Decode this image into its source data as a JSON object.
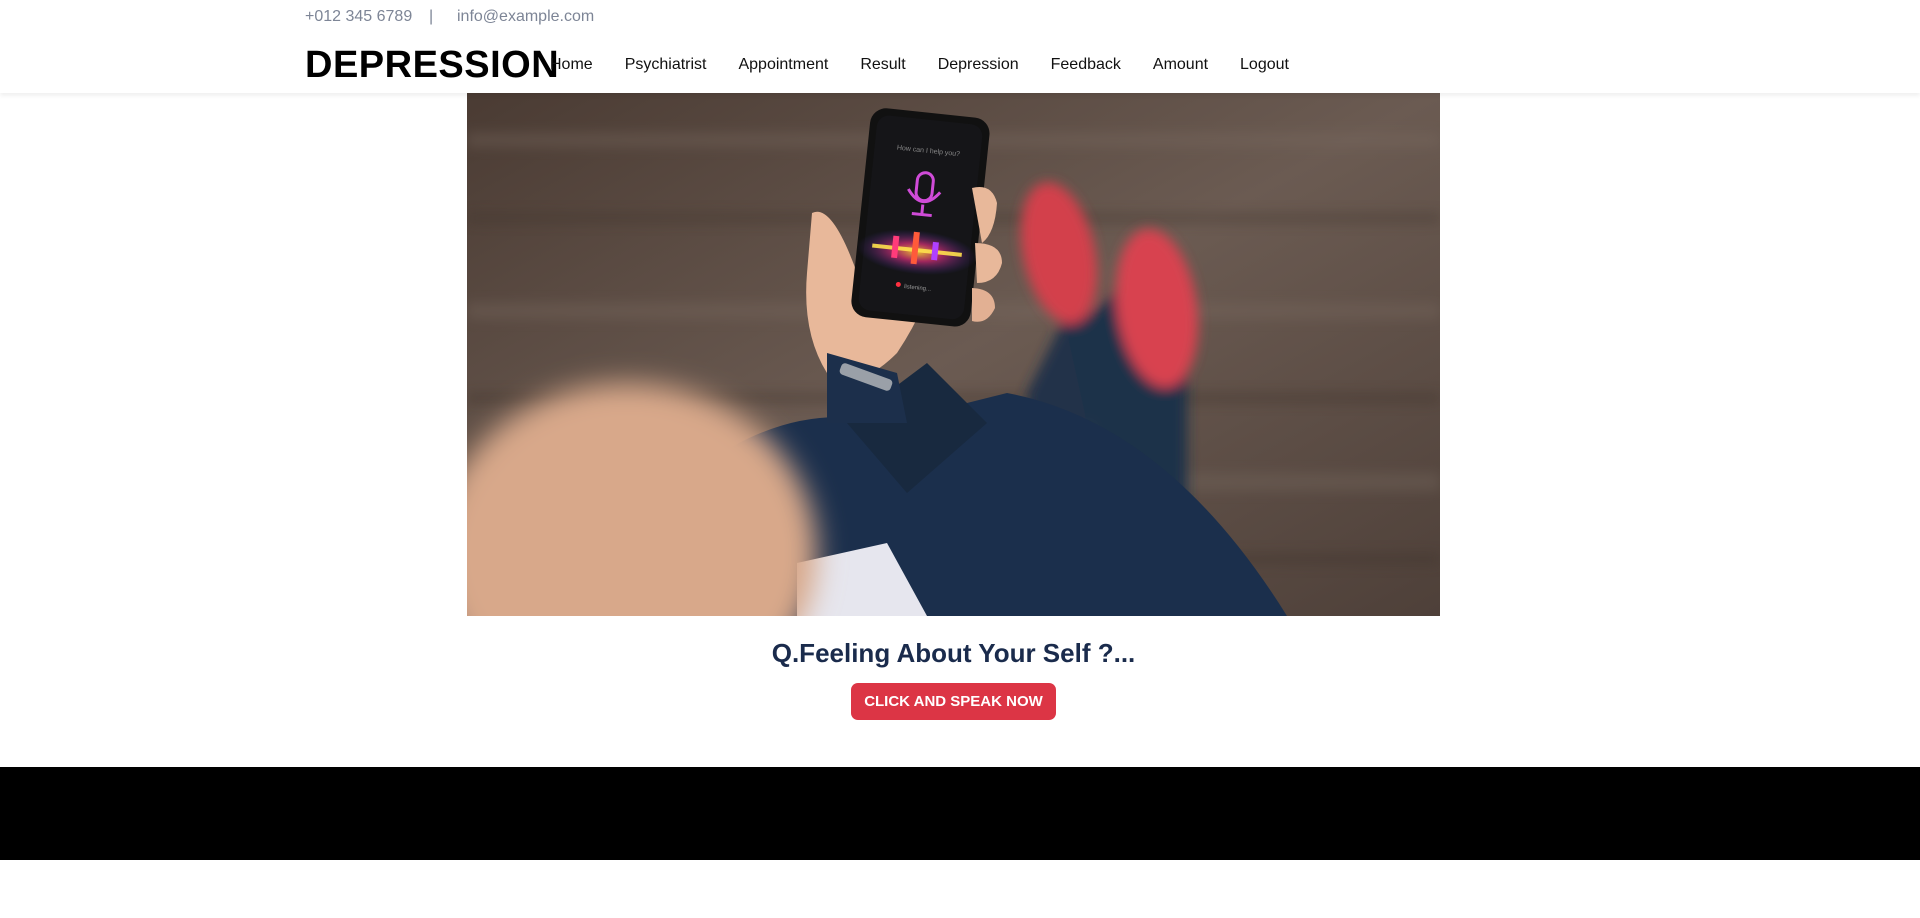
{
  "topbar": {
    "phone": "+012 345 6789",
    "separator": "|",
    "email": "info@example.com"
  },
  "navbar": {
    "brand": "DEPRESSION",
    "items": [
      {
        "label": "Home"
      },
      {
        "label": "Psychiatrist"
      },
      {
        "label": "Appointment"
      },
      {
        "label": "Result"
      },
      {
        "label": "Depression"
      },
      {
        "label": "Feedback"
      },
      {
        "label": "Amount"
      },
      {
        "label": "Logout"
      }
    ]
  },
  "hero": {
    "phone_prompt": "How can I help you?",
    "phone_status": "listening...",
    "colors": {
      "wood": "#5a4a40",
      "jacket": "#1d3350",
      "shoe": "#d8404d",
      "mic": "#d04bd8"
    }
  },
  "main": {
    "question": "Q.Feeling About Your Self ?...",
    "button_label": "CLICK AND SPEAK NOW"
  },
  "colors": {
    "accent": "#dc3545",
    "heading": "#1a2b4c",
    "muted": "#7d8596",
    "footer": "#000000"
  }
}
